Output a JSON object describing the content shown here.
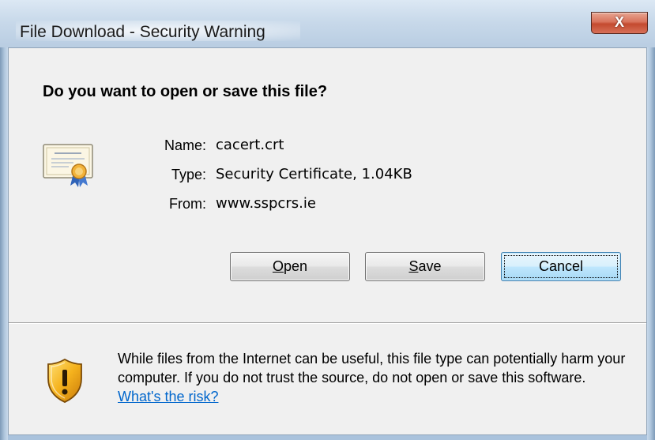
{
  "window": {
    "title": "File Download - Security Warning",
    "close_symbol": "X"
  },
  "dialog": {
    "question": "Do you want to open or save this file?",
    "icon": "certificate-icon",
    "file": {
      "name_label": "Name:",
      "name_value": "cacert.crt",
      "type_label": "Type:",
      "type_value": "Security Certificate, 1.04KB",
      "from_label": "From:",
      "from_value": "www.sspcrs.ie"
    },
    "buttons": {
      "open_mnemonic": "O",
      "open_rest": "pen",
      "save_mnemonic": "S",
      "save_rest": "ave",
      "cancel": "Cancel"
    }
  },
  "warning": {
    "icon": "shield-warning-icon",
    "text": "While files from the Internet can be useful, this file type can potentially harm your computer. If you do not trust the source, do not open or save this software.",
    "link": "What's the risk?"
  },
  "colors": {
    "link": "#0066cc",
    "close_button": "#c34a2f",
    "default_button_border": "#3c7fb1"
  }
}
